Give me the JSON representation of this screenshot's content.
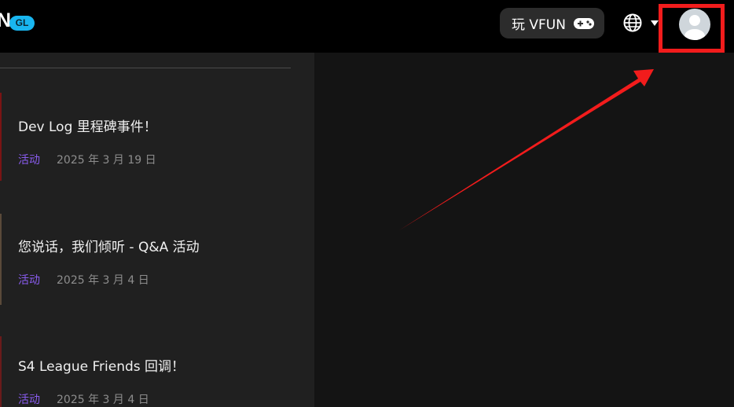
{
  "header": {
    "logo_letter": "N",
    "logo_badge": "GL",
    "play_button_label": "玩 VFUN",
    "play_button_icon": "gamepad-icon",
    "language_icon": "globe-icon",
    "language_caret_icon": "caret-down-icon",
    "profile_icon": "user-avatar-icon"
  },
  "articles": [
    {
      "title": "Dev Log 里程碑事件！",
      "tag": "活动",
      "date": "2025 年 3 月 19 日"
    },
    {
      "title": "您说话，我们倾听 - Q&A 活动",
      "tag": "活动",
      "date": "2025 年 3 月 4 日"
    },
    {
      "title": "S4 League Friends 回调！",
      "tag": "活动",
      "date": "2025 年 3 月 4 日"
    }
  ],
  "colors": {
    "highlight": "#f21c1c",
    "tag": "#8a5cf0",
    "badge": "#19b6f0"
  }
}
